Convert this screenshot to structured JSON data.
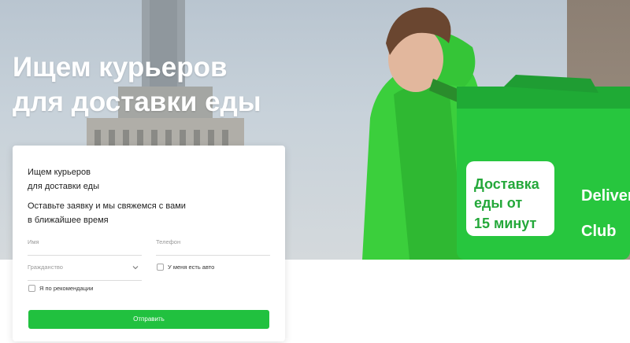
{
  "hero": {
    "title_line1": "Ищем курьеров",
    "title_line2": "для доставки еды",
    "bag_text_line1": "Доставка",
    "bag_text_line2": "еды от",
    "bag_text_line3": "15 минут",
    "bag_brand_line1": "Delivery",
    "bag_brand_line2": "Club"
  },
  "form": {
    "lead_line1": "Ищем курьеров",
    "lead_line2": "для доставки еды",
    "sub_line1": "Оставьте заявку и мы свяжемся с вами",
    "sub_line2": "в ближайшее время",
    "name_placeholder": "Имя",
    "phone_placeholder": "Телефон",
    "citizenship_placeholder": "Гражданство",
    "has_car_label": "У меня есть авто",
    "referral_label": "Я по рекомендации",
    "submit_label": "Отправить"
  },
  "colors": {
    "accent_green": "#21c13f",
    "bag_green": "#27c63e",
    "jacket_green": "#3bcf3c"
  }
}
